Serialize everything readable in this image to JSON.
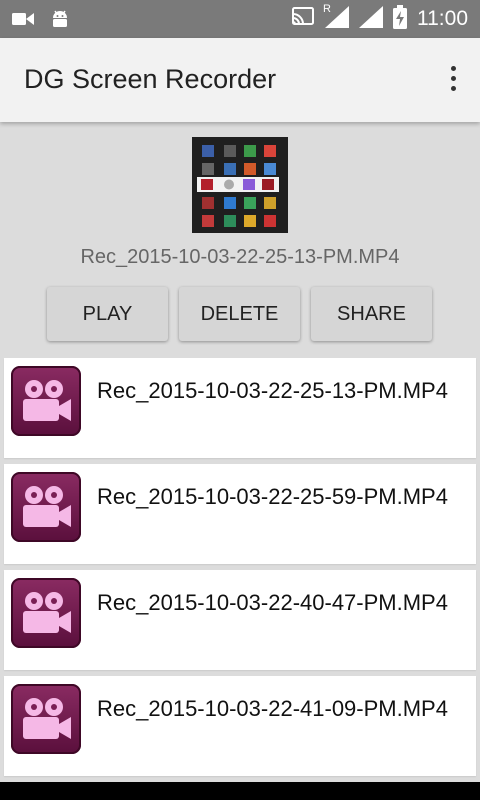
{
  "status_bar": {
    "time": "11:00",
    "network_type": "R",
    "icons": [
      "video-camera-icon",
      "android-icon",
      "cast-icon",
      "signal-icon",
      "signal-roaming-icon",
      "battery-charging-icon"
    ]
  },
  "app_bar": {
    "title": "DG Screen Recorder",
    "overflow_icon": "more-vert-icon"
  },
  "preview": {
    "filename": "Rec_2015-10-03-22-25-13-PM.MP4"
  },
  "actions": {
    "play_label": "PLAY",
    "delete_label": "DELETE",
    "share_label": "SHARE"
  },
  "recordings": [
    {
      "filename": "Rec_2015-10-03-22-25-13-PM.MP4",
      "icon": "video-camera-icon"
    },
    {
      "filename": "Rec_2015-10-03-22-25-59-PM.MP4",
      "icon": "video-camera-icon"
    },
    {
      "filename": "Rec_2015-10-03-22-40-47-PM.MP4",
      "icon": "video-camera-icon"
    },
    {
      "filename": "Rec_2015-10-03-22-41-09-PM.MP4",
      "icon": "video-camera-icon"
    }
  ],
  "colors": {
    "status_bar": "#7a7a7a",
    "app_bar": "#f2f2f2",
    "background": "#dcdcdc",
    "icon_purple": "#7a1f55",
    "icon_pink": "#f5b8e6"
  }
}
